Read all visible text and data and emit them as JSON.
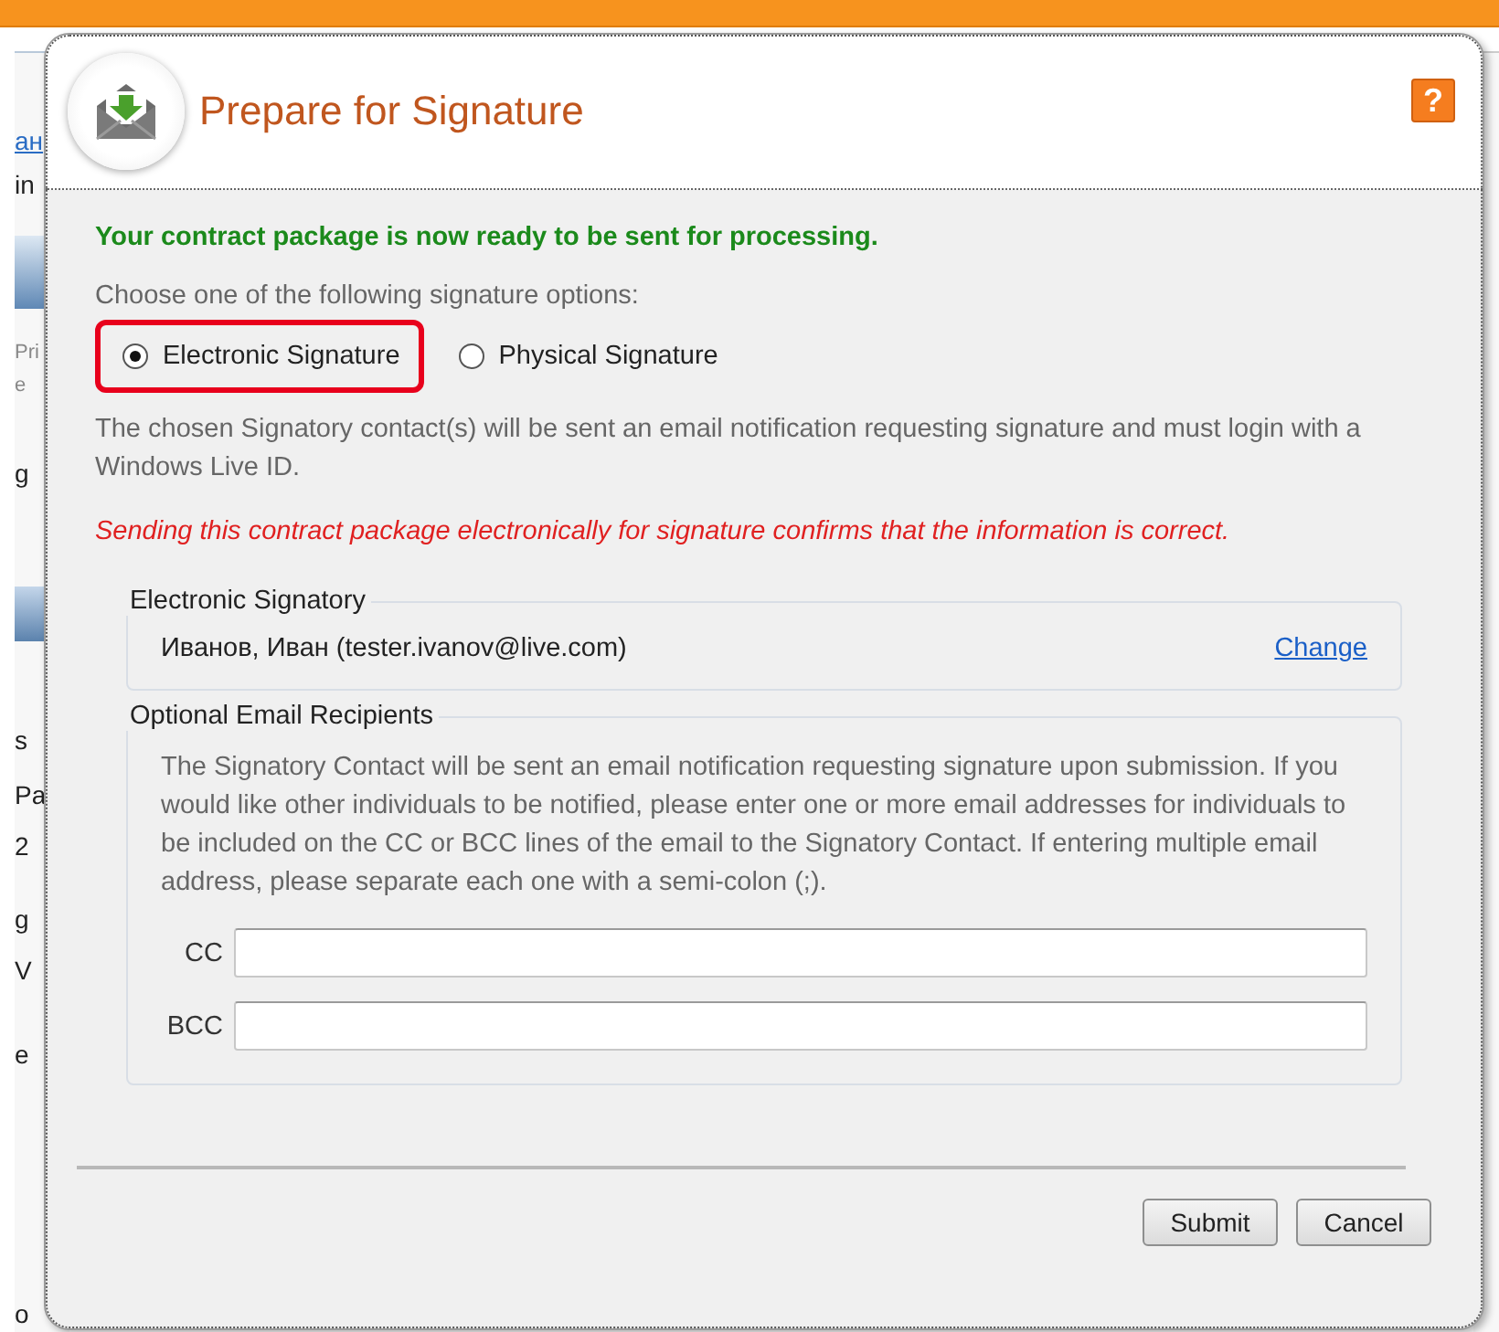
{
  "background": {
    "fragments": [
      {
        "text": "ан",
        "kind": "link"
      },
      {
        "text": "in",
        "kind": "text"
      },
      {
        "text": "Pri",
        "kind": "small"
      },
      {
        "text": "e",
        "kind": "small"
      },
      {
        "text": "g",
        "kind": "text"
      },
      {
        "text": "s",
        "kind": "text"
      },
      {
        "text": "Pa",
        "kind": "text"
      },
      {
        "text": "2",
        "kind": "text"
      },
      {
        "text": "g",
        "kind": "text"
      },
      {
        "text": "V",
        "kind": "text"
      },
      {
        "text": "e",
        "kind": "text"
      },
      {
        "text": "o",
        "kind": "text"
      }
    ]
  },
  "dialog": {
    "title": "Prepare for Signature",
    "help_label": "?",
    "status_message": "Your contract package is now ready to be sent for processing.",
    "prompt": "Choose one of the following signature options:",
    "options": [
      {
        "label": "Electronic Signature",
        "selected": true,
        "highlighted": true
      },
      {
        "label": "Physical Signature",
        "selected": false,
        "highlighted": false
      }
    ],
    "note": "The chosen Signatory contact(s) will be sent an email notification requesting signature and must login with a Windows Live ID.",
    "warning": "Sending this contract package electronically for signature confirms that the information is correct.",
    "signatory": {
      "legend": "Electronic Signatory",
      "contact": "Иванов, Иван (tester.ivanov@live.com)",
      "link": "Change"
    },
    "recipients": {
      "legend": "Optional Email Recipients",
      "description": "The Signatory Contact will be sent an email notification requesting signature upon submission. If you would like other individuals to be notified, please enter one or more email addresses for individuals to be included on the CC or BCC lines of the email to the Signatory Contact. If entering multiple email address, please separate each one with a semi-colon (;).",
      "fields": [
        {
          "label": "CC"
        },
        {
          "label": "BCC"
        }
      ]
    },
    "buttons": [
      {
        "label": "Submit"
      },
      {
        "label": "Cancel"
      }
    ]
  }
}
